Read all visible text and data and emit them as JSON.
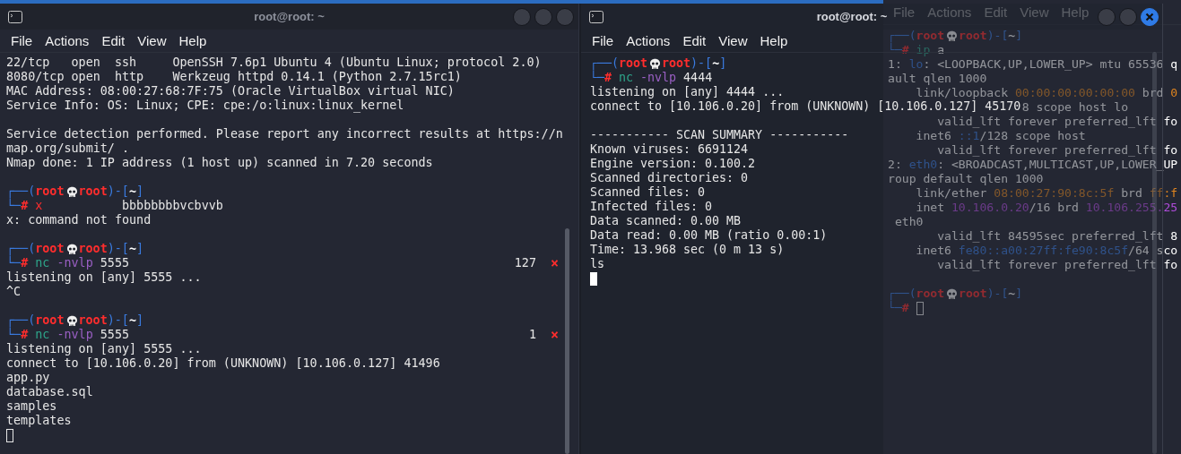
{
  "windows": [
    {
      "title": "root@root: ~",
      "focused": false,
      "scrollbar": true,
      "menu": [
        "File",
        "Actions",
        "Edit",
        "View",
        "Help"
      ],
      "lines": [
        {
          "kind": "output",
          "text": "22/tcp   open  ssh     OpenSSH 7.6p1 Ubuntu 4 (Ubuntu Linux; protocol 2.0)"
        },
        {
          "kind": "output",
          "text": "8080/tcp open  http    Werkzeug httpd 0.14.1 (Python 2.7.15rc1)"
        },
        {
          "kind": "output",
          "text": "MAC Address: 08:00:27:68:7F:75 (Oracle VirtualBox virtual NIC)"
        },
        {
          "kind": "output",
          "text": "Service Info: OS: Linux; CPE: cpe:/o:linux:linux_kernel"
        },
        {
          "kind": "blank"
        },
        {
          "kind": "output",
          "text": "Service detection performed. Please report any incorrect results at https://n"
        },
        {
          "kind": "output",
          "text": "map.org/submit/ ."
        },
        {
          "kind": "output",
          "text": "Nmap done: 1 IP address (1 host up) scanned in 7.20 seconds"
        },
        {
          "kind": "blank"
        },
        {
          "kind": "prompt",
          "parts": [
            {
              "kind": "frame",
              "text": "┌──("
            },
            {
              "kind": "user",
              "text": "root"
            }
          ],
          "after": [
            {
              "kind": "user",
              "text": "root"
            },
            {
              "kind": "frame",
              "text": ")-["
            },
            {
              "kind": "dir",
              "text": "~"
            },
            {
              "kind": "frame",
              "text": "]"
            }
          ]
        },
        {
          "kind": "command",
          "parts": [
            {
              "kind": "frame",
              "text": "└─"
            },
            {
              "kind": "hash",
              "text": "#"
            },
            {
              "kind": "error",
              "text": " x"
            },
            {
              "kind": "plain",
              "text": "           bbbbbbbbvcbvvb"
            }
          ]
        },
        {
          "kind": "output",
          "text": "x: command not found"
        },
        {
          "kind": "blank"
        },
        {
          "kind": "prompt",
          "parts": [
            {
              "kind": "frame",
              "text": "┌──("
            },
            {
              "kind": "user",
              "text": "root"
            }
          ],
          "after": [
            {
              "kind": "user",
              "text": "root"
            },
            {
              "kind": "frame",
              "text": ")-["
            },
            {
              "kind": "dir",
              "text": "~"
            },
            {
              "kind": "frame",
              "text": "]"
            }
          ]
        },
        {
          "kind": "command",
          "parts": [
            {
              "kind": "frame",
              "text": "└─"
            },
            {
              "kind": "hash",
              "text": "#"
            },
            {
              "kind": "cmd",
              "text": " nc"
            },
            {
              "kind": "flag",
              "text": " -nvlp"
            },
            {
              "kind": "plain",
              "text": " 5555"
            }
          ],
          "status": "127",
          "status_mark": "×"
        },
        {
          "kind": "output",
          "text": "listening on [any] 5555 ..."
        },
        {
          "kind": "output",
          "text": "^C"
        },
        {
          "kind": "blank"
        },
        {
          "kind": "prompt",
          "parts": [
            {
              "kind": "frame",
              "text": "┌──("
            },
            {
              "kind": "user",
              "text": "root"
            }
          ],
          "after": [
            {
              "kind": "user",
              "text": "root"
            },
            {
              "kind": "frame",
              "text": ")-["
            },
            {
              "kind": "dir",
              "text": "~"
            },
            {
              "kind": "frame",
              "text": "]"
            }
          ]
        },
        {
          "kind": "command",
          "parts": [
            {
              "kind": "frame",
              "text": "└─"
            },
            {
              "kind": "hash",
              "text": "#"
            },
            {
              "kind": "cmd",
              "text": " nc"
            },
            {
              "kind": "flag",
              "text": " -nvlp"
            },
            {
              "kind": "plain",
              "text": " 5555"
            }
          ],
          "status": "1",
          "status_mark": "×"
        },
        {
          "kind": "output",
          "text": "listening on [any] 5555 ..."
        },
        {
          "kind": "output",
          "text": "connect to [10.106.0.20] from (UNKNOWN) [10.106.0.127] 41496"
        },
        {
          "kind": "output",
          "text": "app.py"
        },
        {
          "kind": "output",
          "text": "database.sql"
        },
        {
          "kind": "output",
          "text": "samples"
        },
        {
          "kind": "output",
          "text": "templates"
        },
        {
          "kind": "cursor",
          "filled": false
        }
      ]
    },
    {
      "title": "root@root: ~",
      "focused": true,
      "translucent": true,
      "scrollbar": true,
      "menu": [
        "File",
        "Actions",
        "Edit",
        "View",
        "Help"
      ],
      "lines": [
        {
          "kind": "prompt",
          "parts": [
            {
              "kind": "frame",
              "text": "┌──("
            },
            {
              "kind": "user",
              "text": "root"
            }
          ],
          "after": [
            {
              "kind": "user",
              "text": "root"
            },
            {
              "kind": "frame",
              "text": ")-["
            },
            {
              "kind": "dir",
              "text": "~"
            },
            {
              "kind": "frame",
              "text": "]"
            }
          ]
        },
        {
          "kind": "command",
          "parts": [
            {
              "kind": "frame",
              "text": "└─"
            },
            {
              "kind": "hash",
              "text": "#"
            },
            {
              "kind": "cmd",
              "text": " nc"
            },
            {
              "kind": "flag",
              "text": " -nvlp"
            },
            {
              "kind": "plain",
              "text": " 4444"
            }
          ]
        },
        {
          "kind": "output",
          "text": "listening on [any] 4444 ..."
        },
        {
          "kind": "output",
          "text": "connect to [10.106.0.20] from (UNKNOWN) [10.106.0.127] 45170"
        },
        {
          "kind": "blank"
        },
        {
          "kind": "output",
          "text": "----------- SCAN SUMMARY -----------"
        },
        {
          "kind": "output",
          "text": "Known viruses: 6691124"
        },
        {
          "kind": "output",
          "text": "Engine version: 0.100.2"
        },
        {
          "kind": "output",
          "text": "Scanned directories: 0"
        },
        {
          "kind": "output",
          "text": "Scanned files: 0"
        },
        {
          "kind": "output",
          "text": "Infected files: 0"
        },
        {
          "kind": "output",
          "text": "Data scanned: 0.00 MB"
        },
        {
          "kind": "output",
          "text": "Data read: 0.00 MB (ratio 0.00:1)"
        },
        {
          "kind": "output",
          "text": "Time: 13.968 sec (0 m 13 s)"
        },
        {
          "kind": "output",
          "text": "ls"
        },
        {
          "kind": "cursor",
          "filled": true
        }
      ]
    },
    {
      "menu": [
        "File",
        "Actions",
        "Edit",
        "View",
        "Help"
      ],
      "lines": [
        {
          "kind": "prompt",
          "parts": [
            {
              "kind": "frame",
              "text": "┌──("
            },
            {
              "kind": "user",
              "text": "root"
            }
          ],
          "after": [
            {
              "kind": "user",
              "text": "root"
            },
            {
              "kind": "frame",
              "text": ")-["
            },
            {
              "kind": "dir",
              "text": "~"
            },
            {
              "kind": "frame",
              "text": "]"
            }
          ]
        },
        {
          "kind": "command",
          "parts": [
            {
              "kind": "frame",
              "text": "└─"
            },
            {
              "kind": "hash",
              "text": "#"
            },
            {
              "kind": "cmd",
              "text": " ip"
            },
            {
              "kind": "plain",
              "text": " a"
            }
          ]
        },
        {
          "kind": "command",
          "parts": [
            {
              "kind": "plain",
              "text": "1: "
            },
            {
              "kind": "iface",
              "text": "lo"
            },
            {
              "kind": "plain",
              "text": ": <LOOPBACK,UP,LOWER_UP> mtu 65536 q"
            }
          ]
        },
        {
          "kind": "output",
          "text": "ault qlen 1000"
        },
        {
          "kind": "command",
          "parts": [
            {
              "kind": "plain",
              "text": "    link/loopback "
            },
            {
              "kind": "mac",
              "text": "00:00:00:00:00:00"
            },
            {
              "kind": "plain",
              "text": " brd "
            },
            {
              "kind": "mac",
              "text": "0"
            }
          ]
        },
        {
          "kind": "output",
          "text": "                   8 scope host lo"
        },
        {
          "kind": "output",
          "text": "       valid_lft forever preferred_lft fo"
        },
        {
          "kind": "command",
          "parts": [
            {
              "kind": "plain",
              "text": "    inet6 "
            },
            {
              "kind": "ip6",
              "text": "::1"
            },
            {
              "kind": "plain",
              "text": "/128 scope host"
            }
          ]
        },
        {
          "kind": "output",
          "text": "       valid_lft forever preferred_lft fo"
        },
        {
          "kind": "command",
          "parts": [
            {
              "kind": "plain",
              "text": "2: "
            },
            {
              "kind": "iface",
              "text": "eth0"
            },
            {
              "kind": "plain",
              "text": ": <BROADCAST,MULTICAST,UP,LOWER_UP"
            }
          ]
        },
        {
          "kind": "output",
          "text": "roup default qlen 1000"
        },
        {
          "kind": "command",
          "parts": [
            {
              "kind": "plain",
              "text": "    link/ether "
            },
            {
              "kind": "mac",
              "text": "08:00:27:90:8c:5f"
            },
            {
              "kind": "plain",
              "text": " brd "
            },
            {
              "kind": "mac",
              "text": "ff:f"
            }
          ]
        },
        {
          "kind": "command",
          "parts": [
            {
              "kind": "plain",
              "text": "    inet "
            },
            {
              "kind": "ip4",
              "text": "10.106.0.20"
            },
            {
              "kind": "plain",
              "text": "/16 brd "
            },
            {
              "kind": "ip4",
              "text": "10.106.255.25"
            }
          ]
        },
        {
          "kind": "output",
          "text": " eth0"
        },
        {
          "kind": "output",
          "text": "       valid_lft 84595sec preferred_lft 8"
        },
        {
          "kind": "command",
          "parts": [
            {
              "kind": "plain",
              "text": "    inet6 "
            },
            {
              "kind": "ip6",
              "text": "fe80::a00:27ff:fe90:8c5f"
            },
            {
              "kind": "plain",
              "text": "/64 sco"
            }
          ]
        },
        {
          "kind": "output",
          "text": "       valid_lft forever preferred_lft fo"
        },
        {
          "kind": "blank"
        },
        {
          "kind": "prompt",
          "parts": [
            {
              "kind": "frame",
              "text": "┌──("
            },
            {
              "kind": "user",
              "text": "root"
            }
          ],
          "after": [
            {
              "kind": "user",
              "text": "root"
            },
            {
              "kind": "frame",
              "text": ")-["
            },
            {
              "kind": "dir",
              "text": "~"
            },
            {
              "kind": "frame",
              "text": "]"
            }
          ]
        },
        {
          "kind": "command",
          "parts": [
            {
              "kind": "frame",
              "text": "└─"
            },
            {
              "kind": "hash",
              "text": "#"
            }
          ],
          "cursor": true,
          "filled": false
        }
      ]
    }
  ]
}
